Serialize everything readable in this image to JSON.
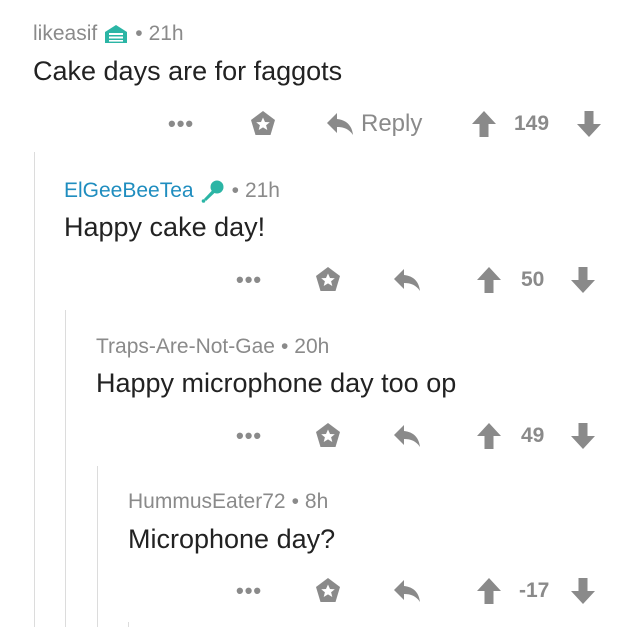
{
  "comments": [
    {
      "author": "likeasif",
      "age": "21h",
      "body": "Cake days are for faggots",
      "flair_icon": "building-flair-icon",
      "reply_label": "Reply",
      "score": "149"
    },
    {
      "author": "ElGeeBeeTea",
      "age": "21h",
      "body": "Happy cake day!",
      "flair_icon": "microphone-flair-icon",
      "score": "50"
    },
    {
      "author": "Traps-Are-Not-Gae",
      "age": "20h",
      "body": "Happy microphone day too op",
      "score": "49"
    },
    {
      "author": "HummusEater72",
      "age": "8h",
      "body": "Microphone day?",
      "score": "-17"
    }
  ],
  "separator": "•",
  "more_glyph": "•••",
  "colors": {
    "text": "#222222",
    "muted": "#8a8a8a",
    "author_blue": "#1f8dbf",
    "flair_teal": "#2bb5a5",
    "thread_line": "#dcdcdc"
  }
}
